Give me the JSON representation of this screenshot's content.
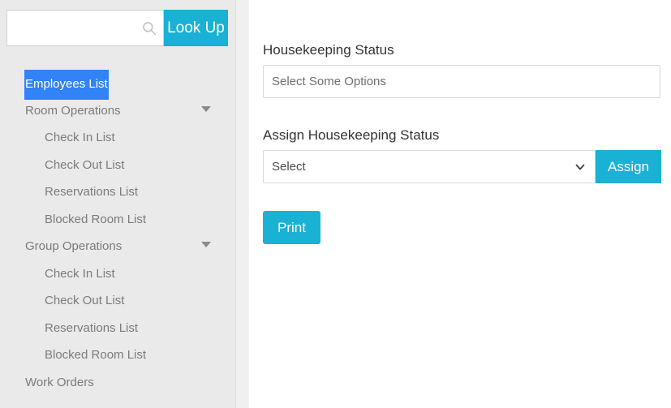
{
  "theme": {
    "accent": "#1ab2d4",
    "sidebar_bg": "#eaeaea",
    "gutter_bg": "#f0f0f0",
    "selection_bg": "#3183f7",
    "nav_text": "#7b7b7b",
    "label_text": "#333333",
    "placeholder_text": "#6f6f6f",
    "border": "#d8d8d8"
  },
  "sidebar": {
    "search": {
      "value": "",
      "placeholder": "",
      "icon": "search-icon",
      "button_label": "Look Up"
    },
    "items": [
      {
        "label": "Employees List",
        "level": 0,
        "selected": true,
        "caret": false
      },
      {
        "label": "Room Operations",
        "level": 0,
        "selected": false,
        "caret": true
      },
      {
        "label": "Check In List",
        "level": 1,
        "selected": false,
        "caret": false
      },
      {
        "label": "Check Out List",
        "level": 1,
        "selected": false,
        "caret": false
      },
      {
        "label": "Reservations List",
        "level": 1,
        "selected": false,
        "caret": false
      },
      {
        "label": "Blocked Room List",
        "level": 1,
        "selected": false,
        "caret": false
      },
      {
        "label": "Group Operations",
        "level": 0,
        "selected": false,
        "caret": true
      },
      {
        "label": "Check In List",
        "level": 1,
        "selected": false,
        "caret": false
      },
      {
        "label": "Check Out List",
        "level": 1,
        "selected": false,
        "caret": false
      },
      {
        "label": "Reservations List",
        "level": 1,
        "selected": false,
        "caret": false
      },
      {
        "label": "Blocked Room List",
        "level": 1,
        "selected": false,
        "caret": false
      },
      {
        "label": "Work Orders",
        "level": 0,
        "selected": false,
        "caret": false
      }
    ]
  },
  "main": {
    "housekeeping_status": {
      "label": "Housekeeping Status",
      "placeholder": "Select Some Options",
      "value": ""
    },
    "assign_housekeeping_status": {
      "label": "Assign Housekeeping Status",
      "selected_option": "Select",
      "dropdown_icon": "chevron-down-icon",
      "button_label": "Assign"
    },
    "print": {
      "button_label": "Print"
    }
  }
}
